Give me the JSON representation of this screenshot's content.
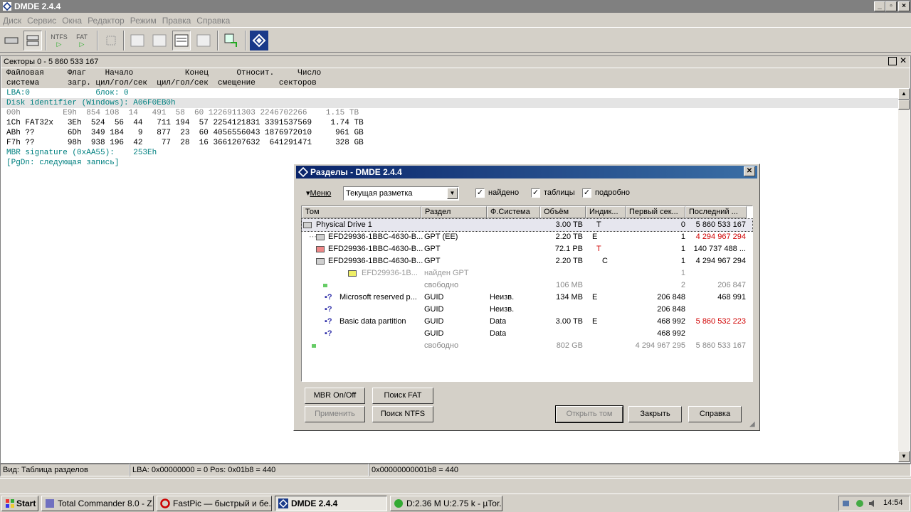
{
  "app": {
    "title": "DMDE 2.4.4"
  },
  "menu": [
    "Диск",
    "Сервис",
    "Окна",
    "Редактор",
    "Режим",
    "Правка",
    "Справка"
  ],
  "toolbar": {
    "ntfs": "NTFS",
    "fat": "FAT"
  },
  "panel": {
    "title": "Секторы 0 - 5 860 533 167",
    "header1": "Файловая     Флаг    Начало           Конец      Относит.     Число",
    "header2": "система      загр. цил/гол/сек  цил/гол/сек  смещение     секторов",
    "lines": [
      {
        "text": "LBA:0              блок: 0"
      },
      {
        "text": "Disk identifier (Windows): A06F0EB0h"
      },
      {
        "text": "00h         E9h  854 108  14   491  58  60 1226911303 2246702266    1.15 TB"
      },
      {
        "text": "1Ch FAT32x   3Eh  524  56  44   711 194  57 2254121831 3391537569    1.74 TB"
      },
      {
        "text": "ABh ??       6Dh  349 184   9   877  23  60 4056556043 1876972010     961 GB"
      },
      {
        "text": "F7h ??       98h  938 196  42    77  28  16 3661207632  641291471     328 GB"
      },
      {
        "text": "MBR signature (0xAA55):    253Eh"
      },
      {
        "text": "[PgDn: следующая запись]"
      }
    ]
  },
  "status": {
    "view": "Вид: Таблица разделов",
    "lba": "LBA: 0x00000000 = 0  Pos: 0x01b8 = 440",
    "offset": "0x00000000001b8 = 440"
  },
  "dialog": {
    "title": "Разделы - DMDE 2.4.4",
    "menu_label": "Меню",
    "layout_select": "Текущая разметка",
    "found": "найдено",
    "tables": "таблицы",
    "detailed": "подробно",
    "columns": [
      "Том",
      "Раздел",
      "Ф.Система",
      "Объём",
      "Индик...",
      "Первый сек...",
      "Последний ..."
    ],
    "rows": [
      {
        "vol": "Physical Drive 1",
        "part": "",
        "fs": "",
        "size": "3.00 TB",
        "ind": "T",
        "first": "0",
        "last": "5 860 533 167"
      },
      {
        "vol": "EFD29936-1BBC-4630-B...",
        "part": "GPT  (EE)",
        "fs": "",
        "size": "2.20 TB",
        "ind": "E",
        "first": "1",
        "last": "4 294 967 294"
      },
      {
        "vol": "EFD29936-1BBC-4630-B...",
        "part": "GPT",
        "fs": "",
        "size": "72.1 PB",
        "ind": "T",
        "first": "1",
        "last": "140 737 488 ..."
      },
      {
        "vol": "EFD29936-1BBC-4630-B...",
        "part": "GPT",
        "fs": "",
        "size": "2.20 TB",
        "ind": "C",
        "first": "1",
        "last": "4 294 967 294"
      },
      {
        "vol": "EFD29936-1B...",
        "part": "найден GPT",
        "fs": "",
        "size": "",
        "ind": "",
        "first": "1",
        "last": ""
      },
      {
        "vol": "",
        "part": "свободно",
        "fs": "",
        "size": "106 MB",
        "ind": "",
        "first": "2",
        "last": "206 847"
      },
      {
        "vol": "Microsoft reserved p...",
        "part": "GUID",
        "fs": "Неизв.",
        "size": "134 MB",
        "ind": "E",
        "first": "206 848",
        "last": "468 991"
      },
      {
        "vol": "",
        "part": "GUID",
        "fs": "Неизв.",
        "size": "",
        "ind": "",
        "first": "206 848",
        "last": ""
      },
      {
        "vol": "Basic data partition",
        "part": "GUID",
        "fs": "Data",
        "size": "3.00 TB",
        "ind": "E",
        "first": "468 992",
        "last": "5 860 532 223"
      },
      {
        "vol": "",
        "part": "GUID",
        "fs": "Data",
        "size": "",
        "ind": "",
        "first": "468 992",
        "last": ""
      },
      {
        "vol": "",
        "part": "свободно",
        "fs": "",
        "size": "802 GB",
        "ind": "",
        "first": "4 294 967 295",
        "last": "5 860 533 167"
      }
    ],
    "buttons": {
      "mbr": "MBR On/Off",
      "fat": "Поиск FAT",
      "apply": "Применить",
      "ntfs": "Поиск NTFS",
      "open": "Открыть том",
      "close": "Закрыть",
      "help": "Справка"
    }
  },
  "taskbar": {
    "start": "Start",
    "tasks": [
      "Total Commander 8.0 - Z...",
      "FastPic — быстрый и бе...",
      "DMDE 2.4.4",
      "D:2.36 M U:2.75 k - µTor..."
    ],
    "clock": "14:54"
  },
  "colors": {
    "red": "#d00000",
    "teal": "#008080",
    "title_active": "#0a246a"
  }
}
